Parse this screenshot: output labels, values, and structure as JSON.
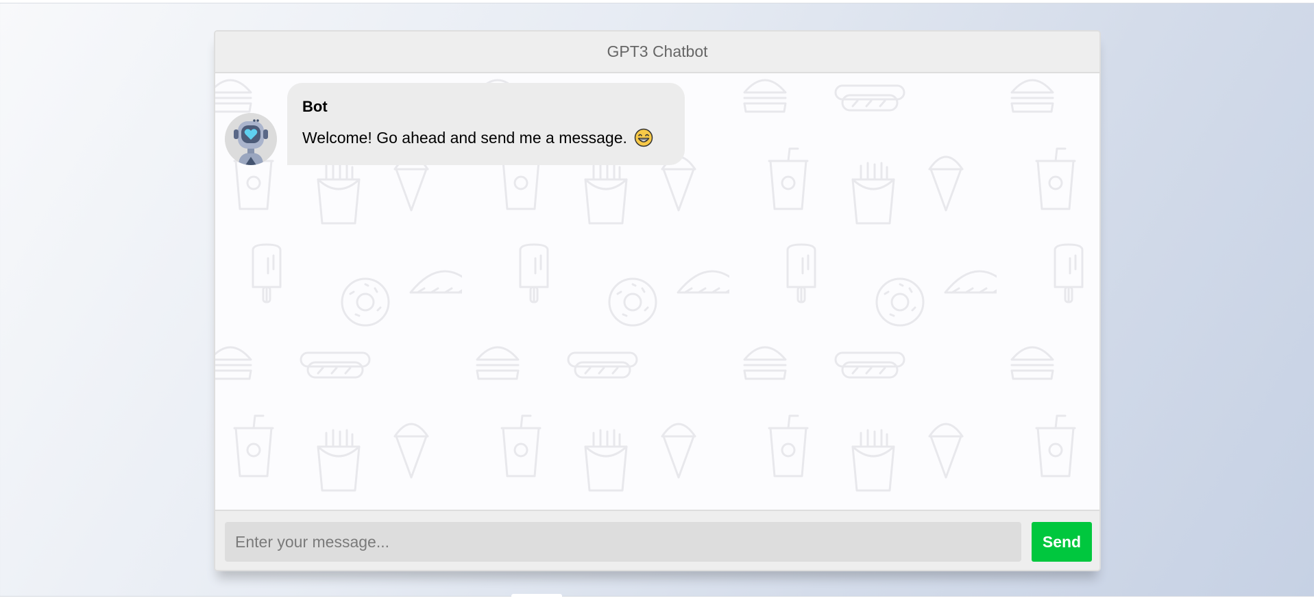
{
  "app": {
    "title": "GPT3 Chatbot"
  },
  "messages": [
    {
      "sender": "Bot",
      "text": "Welcome! Go ahead and send me a message.",
      "emoji_icon": "grinning-face-emoji",
      "avatar_icon": "robot-avatar-icon"
    }
  ],
  "composer": {
    "placeholder": "Enter your message...",
    "value": "",
    "send_label": "Send"
  },
  "colors": {
    "header_bg": "#eeeeee",
    "bubble_bg": "#ececec",
    "input_bg": "#dddddd",
    "send_button": "#00c73e",
    "pattern_stroke": "#e6e6ea"
  }
}
